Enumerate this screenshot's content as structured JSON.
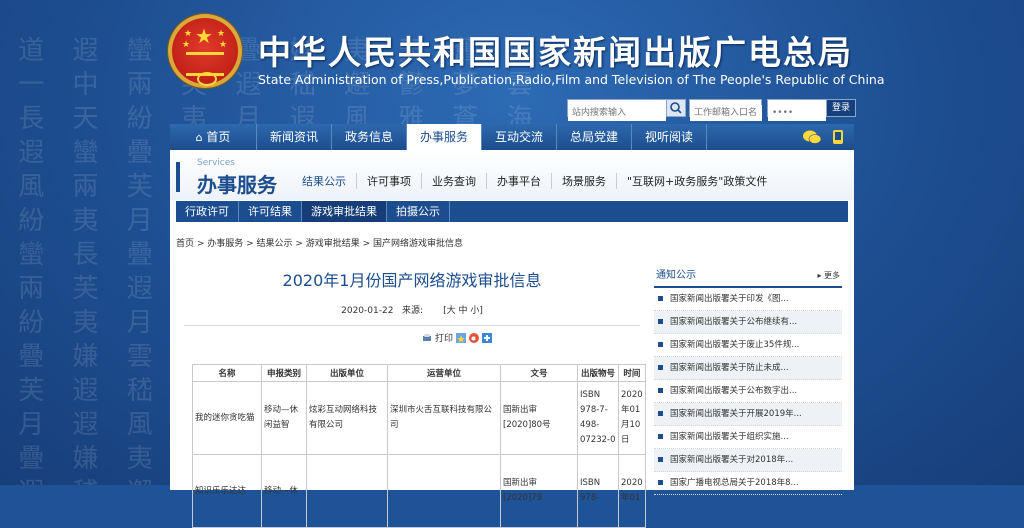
{
  "header": {
    "title_cn": "中华人民共和国国家新闻出版广电总局",
    "title_en": "State Administration of Press,Publication,Radio,Film and Television of The People's Republic of China",
    "search_placeholder": "站内搜索输入",
    "workspace_placeholder": "工作邮箱入口名",
    "password_placeholder": "••••",
    "login_label": "登录"
  },
  "nav": {
    "items": [
      "首页",
      "新闻资讯",
      "政务信息",
      "办事服务",
      "互动交流",
      "总局党建",
      "视听阅读"
    ],
    "active_index": 3
  },
  "services": {
    "en": "Services",
    "cn": "办事服务",
    "tabs": [
      "结果公示",
      "许可事项",
      "业务查询",
      "办事平台",
      "场景服务",
      "\"互联网+政务服务\"政策文件"
    ],
    "subnav": [
      "行政许可",
      "许可结果",
      "游戏审批结果",
      "拍摄公示"
    ],
    "subnav_active": 2
  },
  "breadcrumb": "首页 > 办事服务 > 结果公示 > 游戏审批结果 > 国产网络游戏审批信息",
  "article": {
    "title": "2020年1月份国产网络游戏审批信息",
    "date": "2020-01-22",
    "source_label": "来源:",
    "size_label": "[大 中 小]",
    "print_label": "打印"
  },
  "table": {
    "headers": [
      "名称",
      "申报类别",
      "出版单位",
      "运营单位",
      "文号",
      "出版物号",
      "时间"
    ],
    "rows": [
      [
        "我的迷你贪吃猫",
        "移动—休闲益智",
        "炫彩互动网络科技有限公司",
        "深圳市火舌互联科技有限公司",
        "国新出审[2020]80号",
        "ISBN 978-7-498-07232-0",
        "2020年01月10日"
      ],
      [
        "知识乐乐达达",
        "移动—休",
        "",
        "",
        "国新出审[2020]79",
        "ISBN 978-",
        "2020年01"
      ]
    ]
  },
  "sidebar": {
    "title": "通知公示",
    "more_label": "更多",
    "items": [
      "国家新闻出版署关于印发《图...",
      "国家新闻出版署关于公布继续有...",
      "国家新闻出版署关于废止35件规...",
      "国家新闻出版署关于防止未成...",
      "国家新闻出版署关于公布数字出...",
      "国家新闻出版署关于开展2019年...",
      "国家新闻出版署关于组织实施...",
      "国家新闻出版署关于对2018年...",
      "国家广播电视总局关于2018年8..."
    ]
  }
}
